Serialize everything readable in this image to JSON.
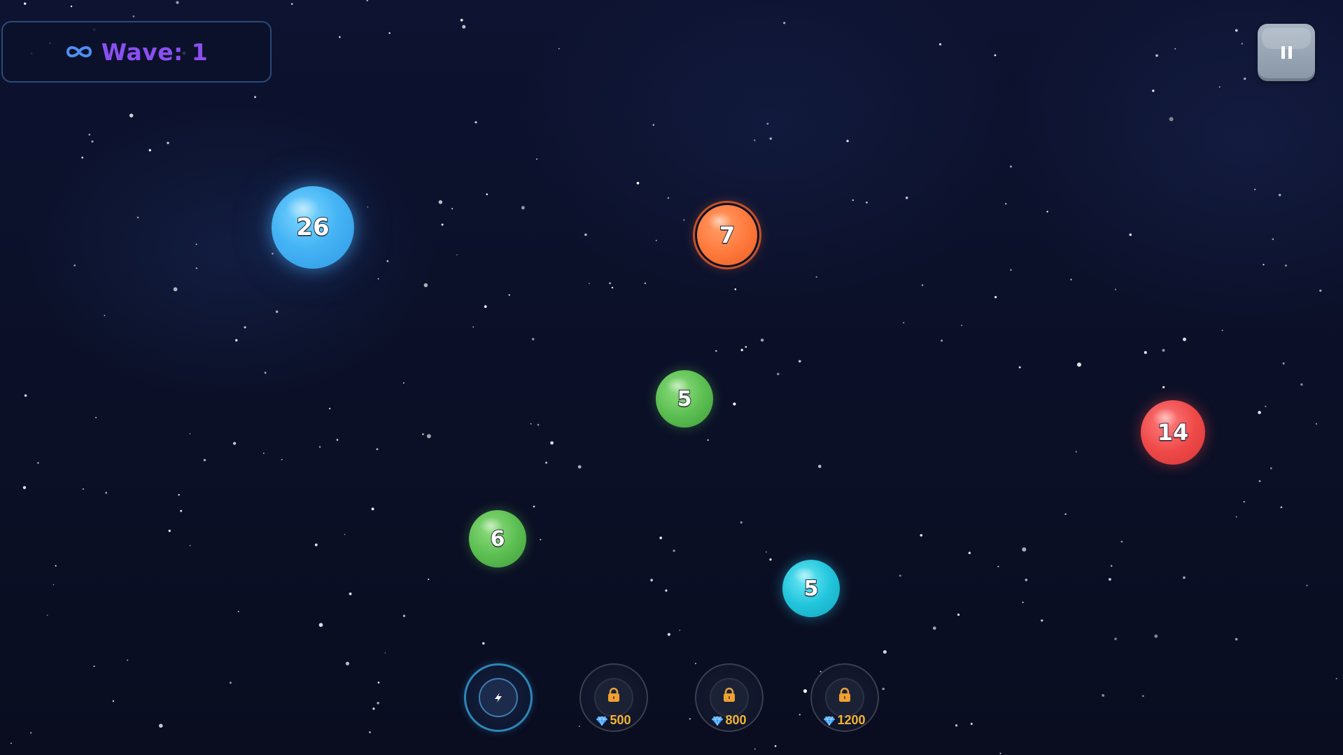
{
  "hud": {
    "wave_label": "Wave: 1",
    "mode_icon": "infinity-icon",
    "pause_icon": "pause-icon"
  },
  "balls": [
    {
      "value": "26",
      "color": "blue"
    },
    {
      "value": "7",
      "color": "orange"
    },
    {
      "value": "5",
      "color": "green"
    },
    {
      "value": "14",
      "color": "red"
    },
    {
      "value": "6",
      "color": "green"
    },
    {
      "value": "5",
      "color": "cyan"
    }
  ],
  "abilities": [
    {
      "icon": "lightning-icon",
      "locked": false
    },
    {
      "icon": "lock-icon",
      "locked": true,
      "cost": "500",
      "currency_icon": "gem-icon"
    },
    {
      "icon": "lock-icon",
      "locked": true,
      "cost": "800",
      "currency_icon": "gem-icon"
    },
    {
      "icon": "lock-icon",
      "locked": true,
      "cost": "1200",
      "currency_icon": "gem-icon"
    }
  ],
  "colors": {
    "wave_text": "#8a4ff0",
    "infinity": "#4f8ff0",
    "cost_text": "#f3b431",
    "gem": "#3aa0ff",
    "lock": "#f0a033"
  }
}
